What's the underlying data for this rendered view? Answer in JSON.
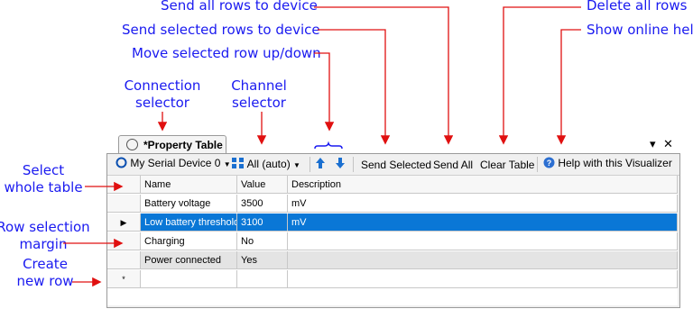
{
  "annotations": {
    "send_all": "Send all rows to device",
    "send_selected": "Send selected rows to device",
    "move": "Move selected row up/down",
    "delete_all": "Delete all rows",
    "help": "Show online help",
    "connection_selector": "Connection\nselector",
    "channel_selector": "Channel\nselector",
    "select_table": "Select\nwhole table",
    "row_margin": "Row selection\nmargin",
    "create_row": "Create\nnew row"
  },
  "tab": {
    "title": "*Property Table",
    "dropdown_glyph": "▾",
    "close_glyph": "✕"
  },
  "toolbar": {
    "connection": "My Serial Device 0",
    "channel": "All (auto)",
    "send_selected": "Send Selected",
    "send_all": "Send All",
    "clear_table": "Clear Table",
    "help": "Help with this Visualizer"
  },
  "table": {
    "columns": [
      "Name",
      "Value",
      "Description"
    ],
    "rows": [
      {
        "name": "Battery voltage",
        "value": "3500",
        "description": "mV"
      },
      {
        "name": "Low battery threshold",
        "value": "3100",
        "description": "mV"
      },
      {
        "name": "Charging",
        "value": "No",
        "description": ""
      },
      {
        "name": "Power connected",
        "value": "Yes",
        "description": ""
      }
    ],
    "new_row_marker": "*"
  },
  "colors": {
    "annotation": "#1a1af0",
    "arrow": "#e01010",
    "selection": "#0a77d6"
  }
}
